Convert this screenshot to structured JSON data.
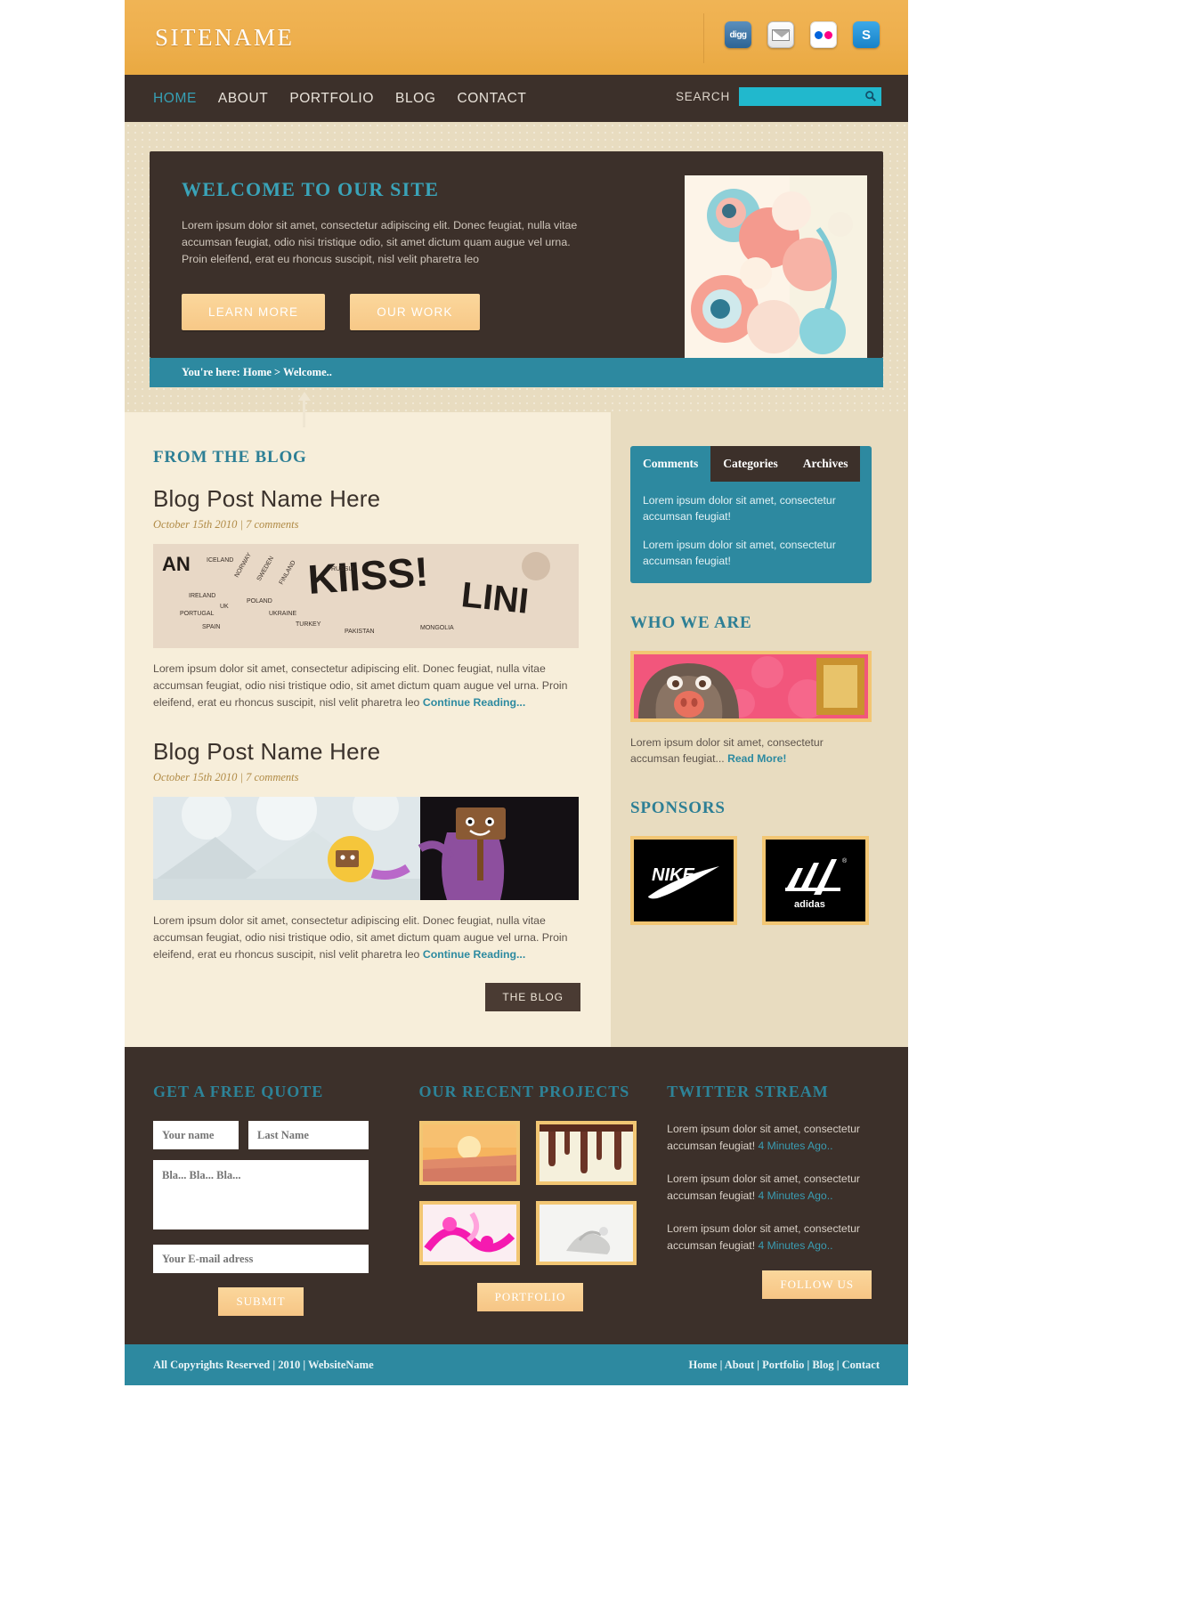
{
  "header": {
    "sitename": "SITENAME",
    "social": [
      {
        "name": "digg-icon",
        "label": "digg"
      },
      {
        "name": "email-icon",
        "label": ""
      },
      {
        "name": "flickr-icon",
        "label": ""
      },
      {
        "name": "skype-icon",
        "label": "S"
      }
    ]
  },
  "nav": {
    "items": [
      {
        "label": "HOME",
        "active": true
      },
      {
        "label": "ABOUT",
        "active": false
      },
      {
        "label": "PORTFOLIO",
        "active": false
      },
      {
        "label": "BLOG",
        "active": false
      },
      {
        "label": "CONTACT",
        "active": false
      }
    ],
    "search_label": "SEARCH",
    "search_value": "",
    "search_placeholder": ""
  },
  "hero": {
    "title": "WELCOME TO OUR SITE",
    "text": "Lorem ipsum dolor sit amet, consectetur adipiscing elit. Donec feugiat, nulla vitae accumsan feugiat, odio nisi tristique odio, sit amet dictum quam augue vel urna. Proin eleifend, erat eu rhoncus suscipit, nisl velit pharetra leo",
    "btn_primary": "LEARN MORE",
    "btn_secondary": "OUR WORK",
    "breadcrumb": "You're here: Home > Welcome.."
  },
  "blog": {
    "section_title": "FROM THE BLOG",
    "posts": [
      {
        "title": "Blog Post Name Here",
        "meta": "October 15th 2010 | 7 comments",
        "body": "Lorem ipsum dolor sit amet, consectetur adipiscing elit. Donec feugiat, nulla vitae accumsan feugiat, odio nisi tristique odio, sit amet dictum quam augue vel urna. Proin eleifend, erat eu rhoncus suscipit, nisl velit pharetra leo ",
        "read_more": "Continue Reading..."
      },
      {
        "title": "Blog Post Name Here",
        "meta": "October 15th 2010 | 7 comments",
        "body": "Lorem ipsum dolor sit amet, consectetur adipiscing elit. Donec feugiat, nulla vitae accumsan feugiat, odio nisi tristique odio, sit amet dictum quam augue vel urna. Proin eleifend, erat eu rhoncus suscipit, nisl velit pharetra leo ",
        "read_more": "Continue Reading..."
      }
    ],
    "blog_button": "THE BLOG"
  },
  "sidebar": {
    "tabs": [
      {
        "label": "Comments",
        "active": true
      },
      {
        "label": "Categories",
        "active": false
      },
      {
        "label": "Archives",
        "active": false
      }
    ],
    "comments": [
      "Lorem ipsum dolor sit amet, consectetur accumsan feugiat!",
      "Lorem ipsum dolor sit amet, consectetur accumsan feugiat!"
    ],
    "who_title": "WHO WE ARE",
    "who_text": "Lorem ipsum dolor sit amet, consectetur accumsan feugiat... ",
    "who_link": "Read More!",
    "sponsors_title": "SPONSORS",
    "sponsors": [
      {
        "name": "nike-logo",
        "label": "NIKE"
      },
      {
        "name": "adidas-logo",
        "label": "adidas"
      }
    ]
  },
  "footer": {
    "quote_title": "GET A FREE QUOTE",
    "field_first_name": "Your name",
    "field_last_name": "Last Name",
    "field_message": "Bla... Bla... Bla...",
    "field_email": "Your E-mail adress",
    "submit_label": "SUBMIT",
    "projects_title": "OUR RECENT PROJECTS",
    "portfolio_label": "PORTFOLIO",
    "twitter_title": "TWITTER STREAM",
    "tweets": [
      {
        "text": "Lorem ipsum dolor sit amet, consectetur accumsan feugiat! ",
        "time": "4 Minutes Ago.."
      },
      {
        "text": "Lorem ipsum dolor sit amet, consectetur accumsan feugiat! ",
        "time": "4 Minutes Ago.."
      },
      {
        "text": "Lorem ipsum dolor sit amet, consectetur accumsan feugiat! ",
        "time": "4 Minutes Ago.."
      }
    ],
    "follow_label": "FOLLOW US",
    "copyright": "All Copyrights Reserved | 2010 | WebsiteName",
    "links": "Home | About | Portfolio | Blog | Contact"
  },
  "colors": {
    "orange": "#eeaf4d",
    "dark_brown": "#3c302a",
    "teal": "#2d89a0",
    "cyan": "#21b8cd",
    "cream": "#f7eeda",
    "tan": "#e8dcc0",
    "gold": "#f2c673"
  }
}
